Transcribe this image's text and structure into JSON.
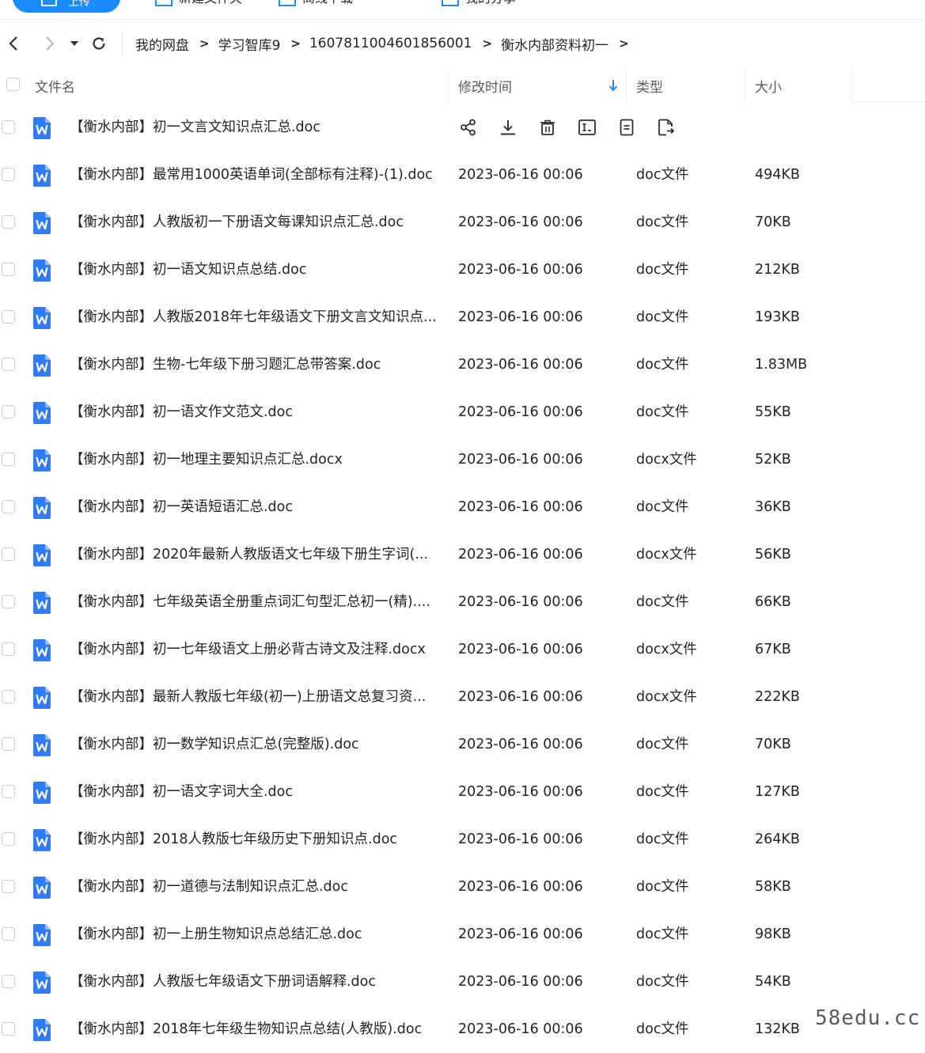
{
  "toolbar": {
    "upload_label": "上传",
    "items": [
      "新建文件夹",
      "离线下载",
      "我的分享"
    ]
  },
  "breadcrumb": [
    "我的网盘",
    "学习智库9",
    "1607811004601856001",
    "衡水内部资料初一"
  ],
  "breadcrumb_separator": ">",
  "columns": {
    "name": "文件名",
    "mtime": "修改时间",
    "type": "类型",
    "size": "大小"
  },
  "sort": {
    "column": "mtime",
    "direction": "down"
  },
  "colors": {
    "accent": "#1a8cff",
    "word_icon": "#2f7cf6"
  },
  "files": [
    {
      "name": "【衡水内部】初一文言文知识点汇总.doc",
      "mtime": "",
      "type": "",
      "size": "",
      "hovered": true
    },
    {
      "name": "【衡水内部】最常用1000英语单词(全部标有注释)-(1).doc",
      "mtime": "2023-06-16 00:06",
      "type": "doc文件",
      "size": "494KB"
    },
    {
      "name": "【衡水内部】人教版初一下册语文每课知识点汇总.doc",
      "mtime": "2023-06-16 00:06",
      "type": "doc文件",
      "size": "70KB"
    },
    {
      "name": "【衡水内部】初一语文知识点总结.doc",
      "mtime": "2023-06-16 00:06",
      "type": "doc文件",
      "size": "212KB"
    },
    {
      "name": "【衡水内部】人教版2018年七年级语文下册文言文知识点...",
      "mtime": "2023-06-16 00:06",
      "type": "doc文件",
      "size": "193KB"
    },
    {
      "name": "【衡水内部】生物-七年级下册习题汇总带答案.doc",
      "mtime": "2023-06-16 00:06",
      "type": "doc文件",
      "size": "1.83MB"
    },
    {
      "name": "【衡水内部】初一语文作文范文.doc",
      "mtime": "2023-06-16 00:06",
      "type": "doc文件",
      "size": "55KB"
    },
    {
      "name": "【衡水内部】初一地理主要知识点汇总.docx",
      "mtime": "2023-06-16 00:06",
      "type": "docx文件",
      "size": "52KB"
    },
    {
      "name": "【衡水内部】初一英语短语汇总.doc",
      "mtime": "2023-06-16 00:06",
      "type": "doc文件",
      "size": "36KB"
    },
    {
      "name": "【衡水内部】2020年最新人教版语文七年级下册生字词(...",
      "mtime": "2023-06-16 00:06",
      "type": "docx文件",
      "size": "56KB"
    },
    {
      "name": "【衡水内部】七年级英语全册重点词汇句型汇总初一(精)....",
      "mtime": "2023-06-16 00:06",
      "type": "doc文件",
      "size": "66KB"
    },
    {
      "name": "【衡水内部】初一七年级语文上册必背古诗文及注释.docx",
      "mtime": "2023-06-16 00:06",
      "type": "docx文件",
      "size": "67KB"
    },
    {
      "name": "【衡水内部】最新人教版七年级(初一)上册语文总复习资...",
      "mtime": "2023-06-16 00:06",
      "type": "docx文件",
      "size": "222KB"
    },
    {
      "name": "【衡水内部】初一数学知识点汇总(完整版).doc",
      "mtime": "2023-06-16 00:06",
      "type": "doc文件",
      "size": "70KB"
    },
    {
      "name": "【衡水内部】初一语文字词大全.doc",
      "mtime": "2023-06-16 00:06",
      "type": "doc文件",
      "size": "127KB"
    },
    {
      "name": "【衡水内部】2018人教版七年级历史下册知识点.doc",
      "mtime": "2023-06-16 00:06",
      "type": "doc文件",
      "size": "264KB"
    },
    {
      "name": "【衡水内部】初一道德与法制知识点汇总.doc",
      "mtime": "2023-06-16 00:06",
      "type": "doc文件",
      "size": "58KB"
    },
    {
      "name": "【衡水内部】初一上册生物知识点总结汇总.doc",
      "mtime": "2023-06-16 00:06",
      "type": "doc文件",
      "size": "98KB"
    },
    {
      "name": "【衡水内部】人教版七年级语文下册词语解释.doc",
      "mtime": "2023-06-16 00:06",
      "type": "doc文件",
      "size": "54KB"
    },
    {
      "name": "【衡水内部】2018年七年级生物知识点总结(人教版).doc",
      "mtime": "2023-06-16 00:06",
      "type": "doc文件",
      "size": "132KB"
    }
  ],
  "row_actions": [
    "share-icon",
    "download-icon",
    "delete-icon",
    "rename-icon",
    "copy-icon",
    "move-icon"
  ],
  "watermark": "58edu.cc"
}
